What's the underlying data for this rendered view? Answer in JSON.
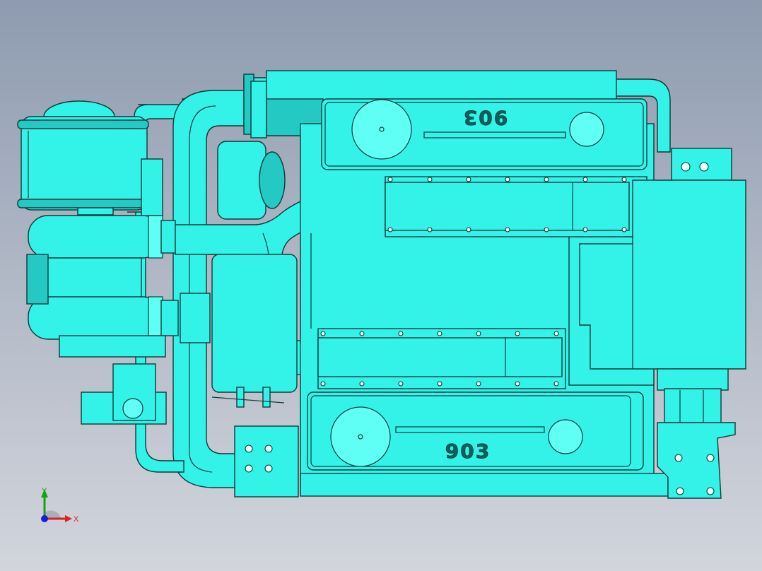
{
  "viewport": {
    "background_top": "#8e9bb0",
    "background_bottom": "#d2d5dc",
    "model_color": "#33f2e8",
    "edge_color": "#0d3b3b"
  },
  "engraving": {
    "top_cover_text": "903",
    "bottom_cover_text": "903"
  },
  "triad": {
    "x_label": "X",
    "y_label": "Y",
    "x_color": "#e02020",
    "y_color": "#18a018",
    "z_color": "#1020e0"
  }
}
